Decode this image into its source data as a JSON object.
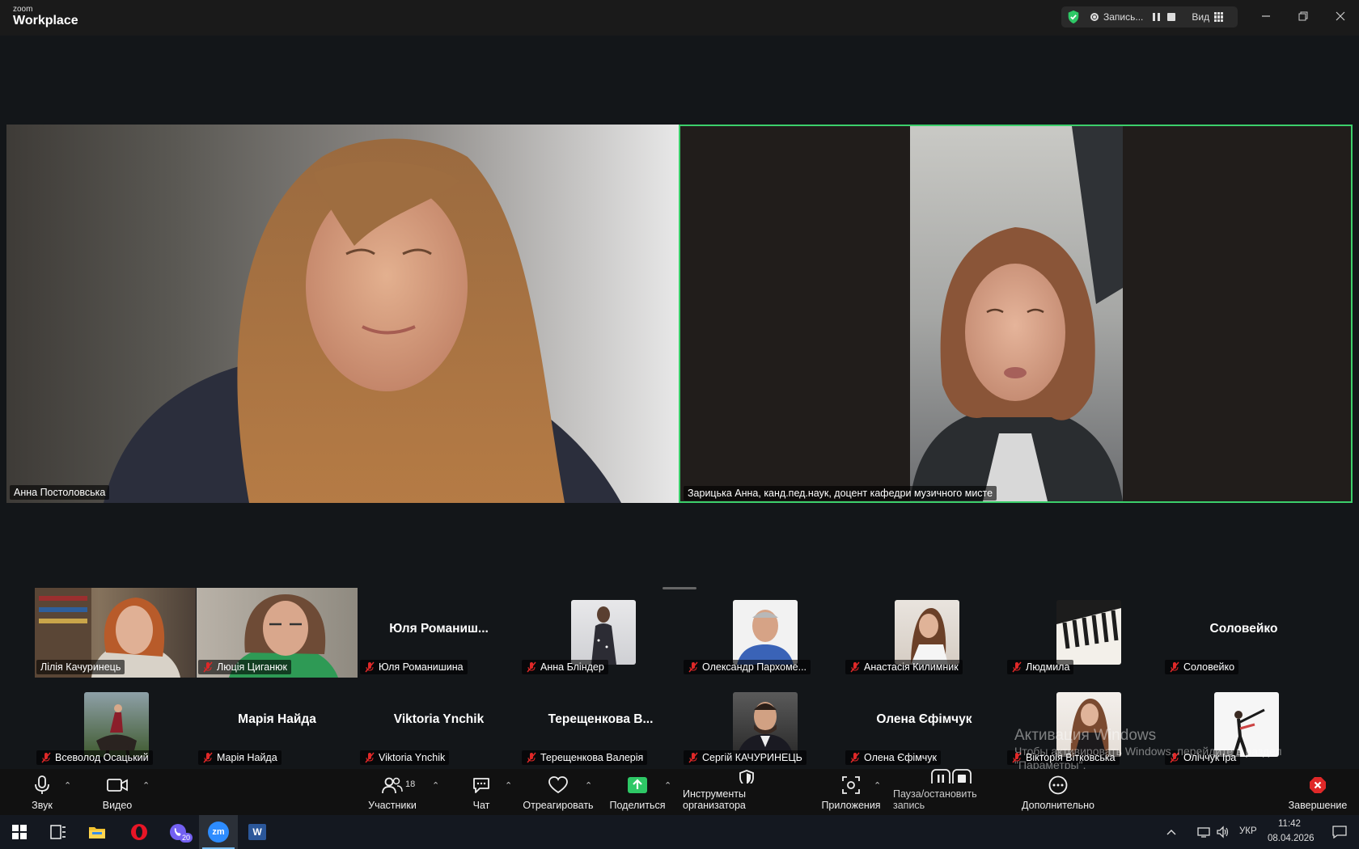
{
  "app": {
    "logo_small": "zoom",
    "logo_big": "Workplace"
  },
  "recording": {
    "label": "Запись...",
    "view_label": "Вид"
  },
  "colors": {
    "active_speaker_border": "#3ccf6b",
    "share_green": "#2ec866",
    "mute_red": "#e02828"
  },
  "main_videos": [
    {
      "name": "Анна Постоловська"
    },
    {
      "name": "Зарицька Анна, канд.пед.наук, доцент кафедри музичного мисте"
    }
  ],
  "gallery": [
    {
      "name": "Лілія Качуринець"
    },
    {
      "name": "Люція Циганюк"
    },
    {
      "display": "Юля  Романиш...",
      "name": "Юля Романишина"
    },
    {
      "name": "Анна Бліндер"
    },
    {
      "name": "Олександр Пархоме..."
    },
    {
      "name": "Анастасія Килимник"
    },
    {
      "name": "Людмила"
    },
    {
      "display": "Соловейко",
      "name": "Соловейко"
    },
    {
      "name": "Всеволод Осацький"
    },
    {
      "display": "Марія Найда",
      "name": "Марія Найда"
    },
    {
      "display": "Viktoria Ynchik",
      "name": "Viktoria Ynchik"
    },
    {
      "display": "Терещенкова  В...",
      "name": "Терещенкова Валерія"
    },
    {
      "name": "Сергій КАЧУРИНЕЦЬ"
    },
    {
      "display": "Олена Єфімчук",
      "name": "Олена Єфімчук"
    },
    {
      "name": "Вікторія Вітковська"
    },
    {
      "name": "Оліччук Іра"
    }
  ],
  "toolbar": {
    "audio": "Звук",
    "video": "Видео",
    "participants": "Участники",
    "participants_count": "18",
    "chat": "Чат",
    "react": "Отреагировать",
    "share": "Поделиться",
    "host_tools": "Инструменты организатора",
    "apps": "Приложения",
    "pause_rec": "Пауза/остановить запись",
    "more": "Дополнительно",
    "end": "Завершение"
  },
  "watermark": {
    "line1": "Активация Windows",
    "line2": "Чтобы активировать Windows, перейдите в раздел",
    "line3": "\"Параметры\"."
  },
  "taskbar": {
    "viber_badge": "20",
    "zoom_label": "zm",
    "word_label": "W",
    "lang": "УКР",
    "time": "11:42",
    "date": "08.04.2026"
  }
}
